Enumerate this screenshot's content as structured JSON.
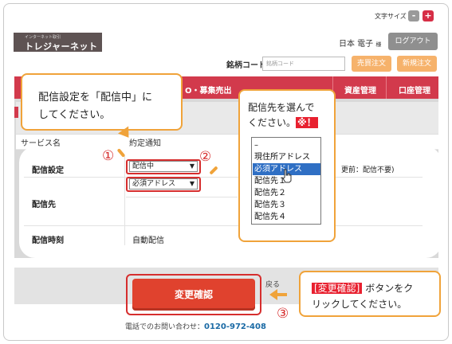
{
  "header": {
    "font_size_label": "文字サイズ",
    "font_minus": "-",
    "font_plus": "+",
    "logo_sub": "インターネット取引",
    "logo_main": "トレジャーネット",
    "user_name": "日本 電子",
    "user_suffix": "様",
    "logout_label": "ログアウト",
    "stock_code_label": "銘柄コード",
    "stock_code_placeholder": "銘柄コード",
    "sell_button": "売買注文",
    "new_button": "新規注文"
  },
  "nav": {
    "partial_item": "O・募集売出",
    "item2": "資産管理",
    "item3": "口座管理"
  },
  "service_row": {
    "label": "サービス名",
    "value": "約定通知"
  },
  "form": {
    "delivery_setting_label": "配信設定",
    "delivery_setting_value": "配信中",
    "delivery_target_label": "配信先",
    "delivery_target_value": "必須アドレス",
    "delivery_time_label": "配信時刻",
    "delivery_time_value": "自動配信",
    "right_note": "更前：配信不要)"
  },
  "callout1": {
    "number": "①",
    "line1": "配信設定を「配信中」に",
    "line2": "してください。"
  },
  "callout2": {
    "number": "②",
    "line1": "配信先を選んで",
    "line2": "ください。",
    "warning": "※！",
    "options": [
      "–",
      "現住所アドレス",
      "必須アドレス",
      "配信先１",
      "配信先２",
      "配信先３",
      "配信先４"
    ],
    "selected_index": 2
  },
  "callout3": {
    "number": "③",
    "tag": "[変更確認]",
    "line1_rest": "ボタンをク",
    "line2": "リックしてください。"
  },
  "footer": {
    "submit_label": "変更確認",
    "back_label": "戻る",
    "phone_label": "電話でのお問い合わせ：",
    "phone_number": "0120-972-408"
  },
  "colors": {
    "brand_red": "#d23a4c",
    "accent_orange": "#f0a33a",
    "select_blue": "#2f6fc4"
  }
}
